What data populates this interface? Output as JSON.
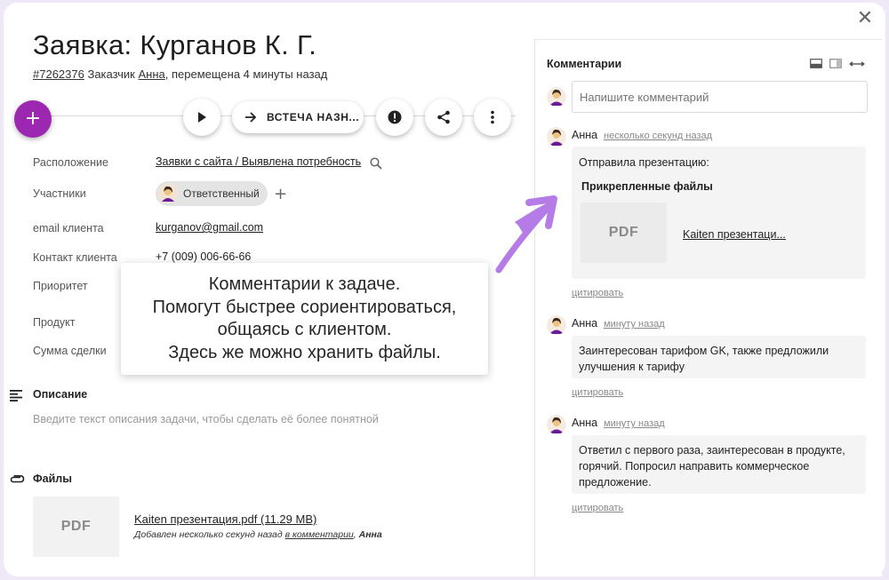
{
  "header": {
    "title": "Заявка: Курганов К. Г.",
    "task_id": "#7262376",
    "customer_prefix": "Заказчик",
    "customer_name": "Анна",
    "moved_text": ", перемещена 4 минуты назад"
  },
  "toolbar": {
    "add_label": "+",
    "stage_label": "ВСТЕЧА НАЗН..."
  },
  "properties": {
    "location_label": "Расположение",
    "location_value": "Заявки с сайта / Выявлена потребность",
    "participants_label": "Участники",
    "participant_chip": "Ответственный",
    "email_label": "email клиента",
    "email_value": "kurganov@gmail.com",
    "contact_label": "Контакт клиента",
    "contact_value": "+7 (009) 006-66-66",
    "priority_label": "Приоритет",
    "product_label": "Продукт",
    "deal_label": "Сумма сделки"
  },
  "tooltip": {
    "lines": [
      "Комментарии к задаче.",
      "Помогут быстрее сориентироваться,",
      "общаясь с клиентом.",
      "Здесь же можно хранить файлы."
    ]
  },
  "description": {
    "title": "Описание",
    "placeholder": "Введите текст описания задачи, чтобы сделать её более понятной"
  },
  "files": {
    "title": "Файлы",
    "thumb_label": "PDF",
    "file_name": "Kaiten презентация.pdf (11.29 MB)",
    "added_prefix": "Добавлен несколько секунд назад ",
    "added_link": "в комментарии",
    "added_sep": ", ",
    "added_author": "Анна"
  },
  "comments": {
    "title": "Комментарии",
    "input_placeholder": "Напишите комментарий",
    "quote_label": "цитировать",
    "attached_title": "Прикрепленные файлы",
    "attached_pdf_label": "PDF",
    "attached_file_name": "Kaiten презентаци...",
    "items": [
      {
        "author": "Анна",
        "time": "несколько секунд назад",
        "text": "Отправила презентацию:"
      },
      {
        "author": "Анна",
        "time": "минуту назад",
        "text": "Заинтересован тарифом GK, также предложили улучшения к тарифу"
      },
      {
        "author": "Анна",
        "time": "минуту назад",
        "text": "Ответил с первого раза, заинтересован в продукте, горячий. Попросил направить коммерческое предложение."
      }
    ]
  },
  "colors": {
    "accent": "#9c27b0",
    "arrow": "#b57be6"
  },
  "icons": {
    "close": "close-icon",
    "play": "play-icon",
    "arrow": "arrow-right-icon",
    "alert": "alert-icon",
    "share": "share-icon",
    "more": "more-vertical-icon",
    "search": "search-icon",
    "description": "text-lines-icon",
    "attachment": "paperclip-icon"
  }
}
